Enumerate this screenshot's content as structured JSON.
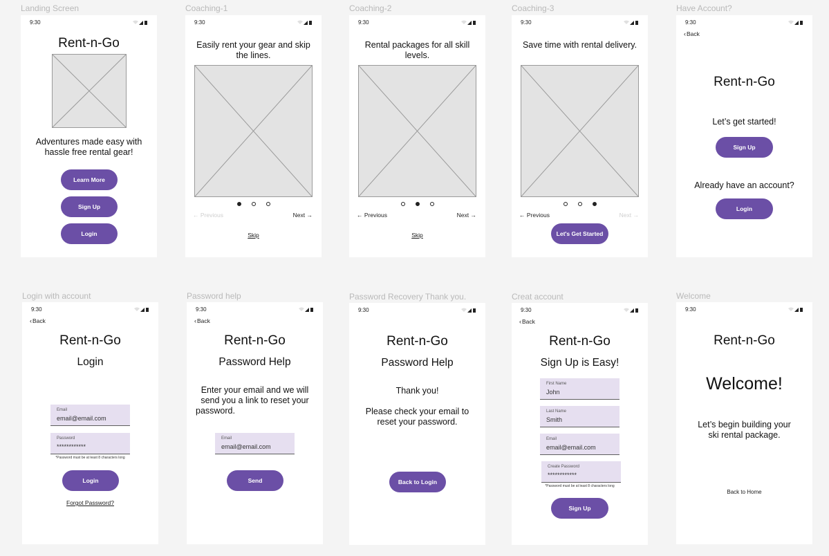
{
  "labels": {
    "landing": "Landing Screen",
    "coach1": "Coaching-1",
    "coach2": "Coaching-2",
    "coach3": "Coaching-3",
    "have": "Have Account?",
    "login": "Login with account",
    "pwhelp": "Password help",
    "pwthanks": "Password Recovery Thank you.",
    "create": "Creat account",
    "welcome": "Welcome"
  },
  "status": {
    "time": "9:30"
  },
  "brand": "Rent-n-Go",
  "back": "Back",
  "landing": {
    "tagline_1": "Adventures made easy with",
    "tagline_2": "hassle free rental gear!",
    "learn_more": "Learn More",
    "sign_up": "Sign Up",
    "login": "Login"
  },
  "coach1": {
    "text_1": "Easily rent your gear and skip",
    "text_2": "the lines.",
    "previous": "Previous",
    "next": "Next",
    "skip": "Skip"
  },
  "coach2": {
    "text_1": "Rental packages for all skill",
    "text_2": "levels.",
    "previous": "Previous",
    "next": "Next",
    "skip": "Skip"
  },
  "coach3": {
    "text_1": "Save time with rental delivery.",
    "previous": "Previous",
    "next": "Next",
    "cta": "Let's Get Started"
  },
  "have": {
    "lets_start": "Let’s get started!",
    "sign_up": "Sign Up",
    "already": "Already have an account?",
    "login": "Login"
  },
  "login": {
    "heading": "Login",
    "email_label": "Email",
    "email_value": "email@email.com",
    "password_label": "Password",
    "password_value": "************",
    "hint": "*Password must be at least 8 characters long",
    "button": "Login",
    "forgot": "Forgot Password?"
  },
  "pwhelp": {
    "heading": "Password Help",
    "text_1": "Enter your email and we will",
    "text_2": "send you a link to reset your",
    "text_3": "password.",
    "email_label": "Email",
    "email_value": "email@email.com",
    "send": "Send"
  },
  "pwthanks": {
    "heading": "Password Help",
    "thanks": "Thank you!",
    "text_1": "Please check your email to",
    "text_2": "reset your password.",
    "back_to_login": "Back to Login"
  },
  "create": {
    "heading": "Sign Up is Easy!",
    "first_label": "First Name",
    "first_value": "John",
    "last_label": "Last Name",
    "last_value": "Smith",
    "email_label": "Email",
    "email_value": "email@email.com",
    "password_label": "Create Password",
    "password_value": "************",
    "hint": "*Password must be at least 8 characters long",
    "sign_up": "Sign Up"
  },
  "welcome": {
    "heading": "Welcome!",
    "text_1": "Let’s begin building your",
    "text_2": "ski rental package.",
    "back_home": "Back to Home"
  },
  "colors": {
    "accent": "#6b4fa6",
    "field_bg": "#e6dff0",
    "canvas": "#f4f4f4",
    "frame_label": "#b9b9b9"
  },
  "icons": [
    "wifi-icon",
    "signal-icon",
    "battery-icon",
    "chevron-left-icon",
    "arrow-left-icon",
    "arrow-right-icon",
    "image-placeholder-icon"
  ]
}
